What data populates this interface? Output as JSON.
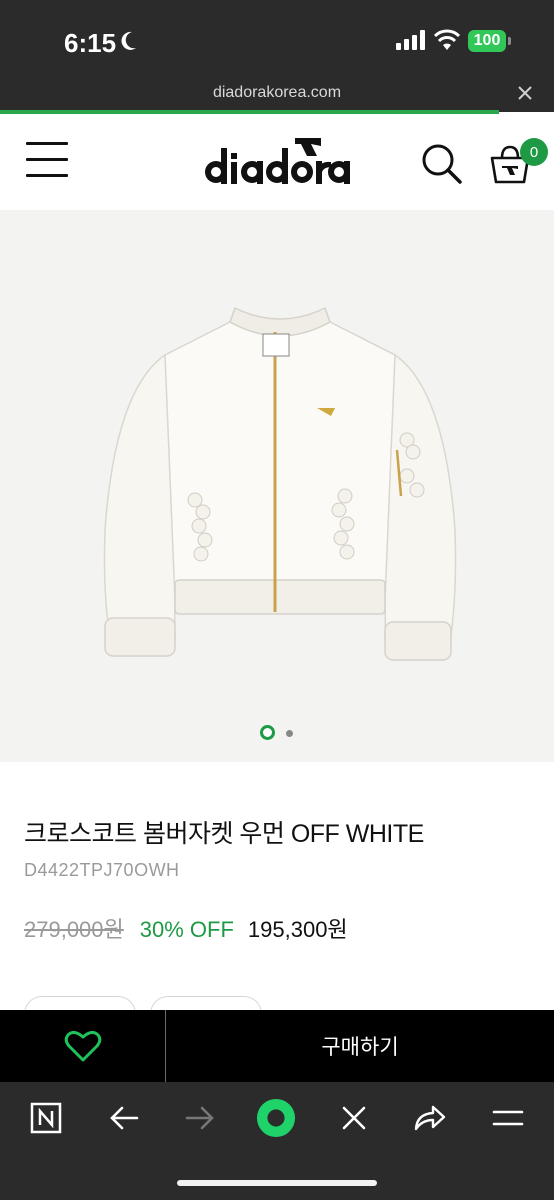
{
  "status_bar": {
    "time": "6:15",
    "battery_level": "100",
    "battery_color": "#32c759"
  },
  "browser": {
    "url": "diadorakorea.com",
    "close_icon": "close-icon",
    "load_progress_percent": 90,
    "toolbar_icons": [
      "naver-home-icon",
      "back-arrow-icon",
      "forward-arrow-icon",
      "green-dot-icon",
      "close-icon",
      "share-icon",
      "menu-icon"
    ]
  },
  "header": {
    "logo_text": "diadora",
    "menu_icon": "hamburger-menu-icon",
    "search_icon": "search-icon",
    "cart_icon": "shopping-bag-icon",
    "cart_count": "0"
  },
  "product": {
    "image_alt_icon": "white-bomber-jacket-image",
    "image_count": 2,
    "active_image": 1,
    "name": "크로스코트 봄버자켓 우먼 OFF WHITE",
    "code": "D4422TPJ70OWH",
    "original_price": "279,000원",
    "discount": "30% OFF",
    "sale_price": "195,300원"
  },
  "buy_bar": {
    "wish_icon": "heart-icon",
    "buy_label": "구매하기"
  },
  "colors": {
    "accent_green": "#1e9a45",
    "dark_bar": "#2b2b2b",
    "buy_bar": "#000000"
  }
}
